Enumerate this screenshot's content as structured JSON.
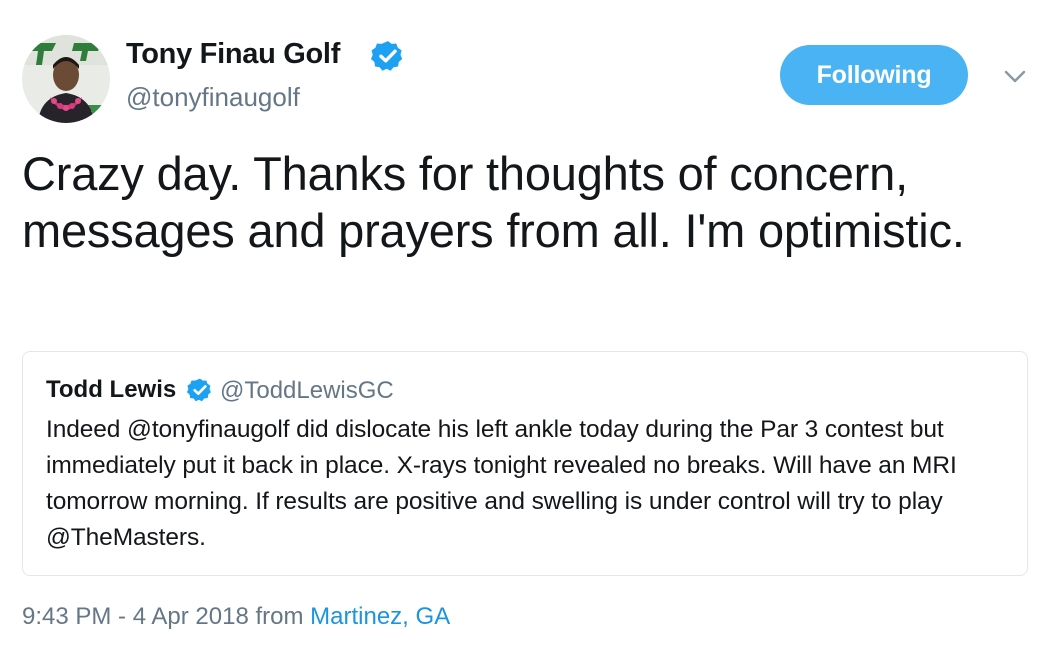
{
  "author": {
    "display_name": "Tony Finau Golf",
    "handle": "@tonyfinaugolf",
    "verified": true,
    "avatar_icon": "profile-photo"
  },
  "follow_button": {
    "label": "Following",
    "color": "#4ab3f4"
  },
  "menu_icon": "chevron-down-icon",
  "tweet": {
    "text": "Crazy day. Thanks for thoughts of concern, messages and prayers from all. I'm optimistic."
  },
  "quoted_tweet": {
    "display_name": "Todd Lewis",
    "handle": "@ToddLewisGC",
    "verified": true,
    "text": "Indeed @tonyfinaugolf did dislocate his left ankle today during the Par 3 contest but immediately put it back in place. X-rays tonight revealed no breaks.  Will have an MRI tomorrow morning. If results are positive and swelling is under control will try to play @TheMasters."
  },
  "meta": {
    "time_date": "9:43 PM - 4 Apr 2018",
    "from_word": "from",
    "location": "Martinez, GA"
  },
  "colors": {
    "text": "#14171a",
    "secondary": "#657786",
    "link": "#1b95e0",
    "verified": "#1da1f2",
    "border": "#e1e8ed"
  }
}
